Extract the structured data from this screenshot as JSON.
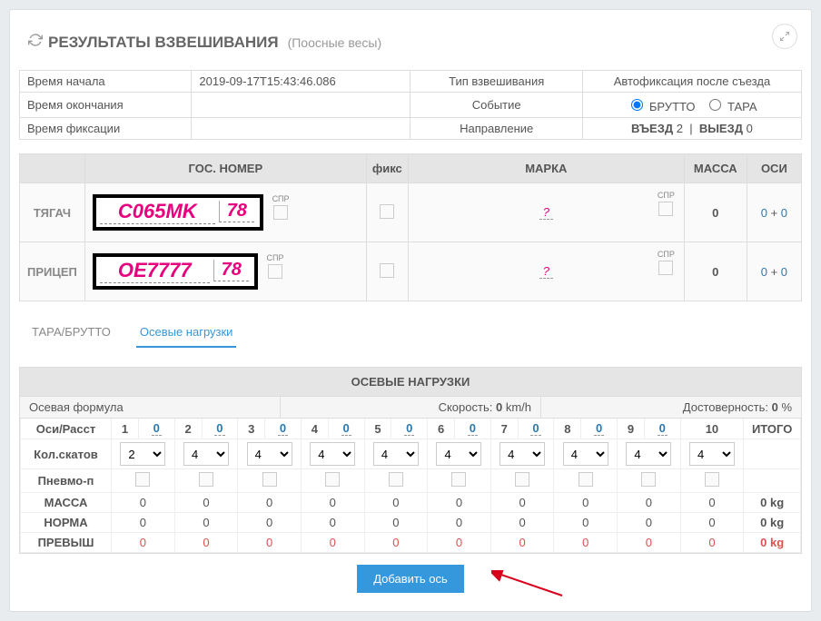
{
  "panel": {
    "title": "РЕЗУЛЬТАТЫ ВЗВЕШИВАНИЯ",
    "subtitle": "(Поосные весы)"
  },
  "info": {
    "rows": [
      {
        "l1": "Время начала",
        "v1": "2019-09-17T15:43:46.086",
        "l2": "Тип взвешивания",
        "v2": "Автофиксация после съезда"
      },
      {
        "l1": "Время окончания",
        "v1": "",
        "l2": "Событие",
        "v2_radio": {
          "o1": "БРУТТО",
          "o2": "ТАРА"
        }
      },
      {
        "l1": "Время фиксации",
        "v1": "",
        "l2": "Направление",
        "v2_inout": {
          "in_lbl": "ВЪЕЗД",
          "in_v": "2",
          "out_lbl": "ВЫЕЗД",
          "out_v": "0"
        }
      }
    ]
  },
  "vehicle_headers": {
    "plate": "ГОС. НОМЕР",
    "fix": "фикс",
    "brand": "МАРКА",
    "mass": "МАССА",
    "axles": "ОСИ"
  },
  "spr_label": "СПР",
  "vehicles": [
    {
      "label": "ТЯГАЧ",
      "plate_main": "C065MK",
      "plate_region": "78",
      "brand": "?",
      "mass": "0",
      "axles_a": "0",
      "axles_b": "0"
    },
    {
      "label": "ПРИЦЕП",
      "plate_main": "OE7777",
      "plate_region": "78",
      "brand": "?",
      "mass": "0",
      "axles_a": "0",
      "axles_b": "0"
    }
  ],
  "tabs": {
    "tara": "ТАРА/БРУТТО",
    "axle": "Осевые нагрузки"
  },
  "axle_panel": {
    "title": "ОСЕВЫЕ НАГРУЗКИ",
    "formula_label": "Осевая формула",
    "speed_label": "Скорость:",
    "speed_value": "0",
    "speed_unit": "km/h",
    "reliab_label": "Достоверность:",
    "reliab_value": "0",
    "reliab_unit": "%",
    "axle_row_label": "Оси/Расст",
    "count_label": "Кол.скатов",
    "pneumo_label": "Пневмо-п",
    "mass_label": "МАССА",
    "norm_label": "НОРМА",
    "over_label": "ПРЕВЫШ",
    "total_label": "ИТОГО",
    "total_mass": "0 kg",
    "total_norm": "0 kg",
    "total_over": "0 kg",
    "axle_numbers": [
      "1",
      "2",
      "3",
      "4",
      "5",
      "6",
      "7",
      "8",
      "9",
      "10"
    ],
    "distances": [
      "0",
      "0",
      "0",
      "0",
      "0",
      "0",
      "0",
      "0",
      "0"
    ],
    "skats": [
      "2",
      "4",
      "4",
      "4",
      "4",
      "4",
      "4",
      "4",
      "4",
      "4"
    ],
    "zeros": [
      "0",
      "0",
      "0",
      "0",
      "0",
      "0",
      "0",
      "0",
      "0",
      "0"
    ]
  },
  "add_button": "Добавить ось"
}
